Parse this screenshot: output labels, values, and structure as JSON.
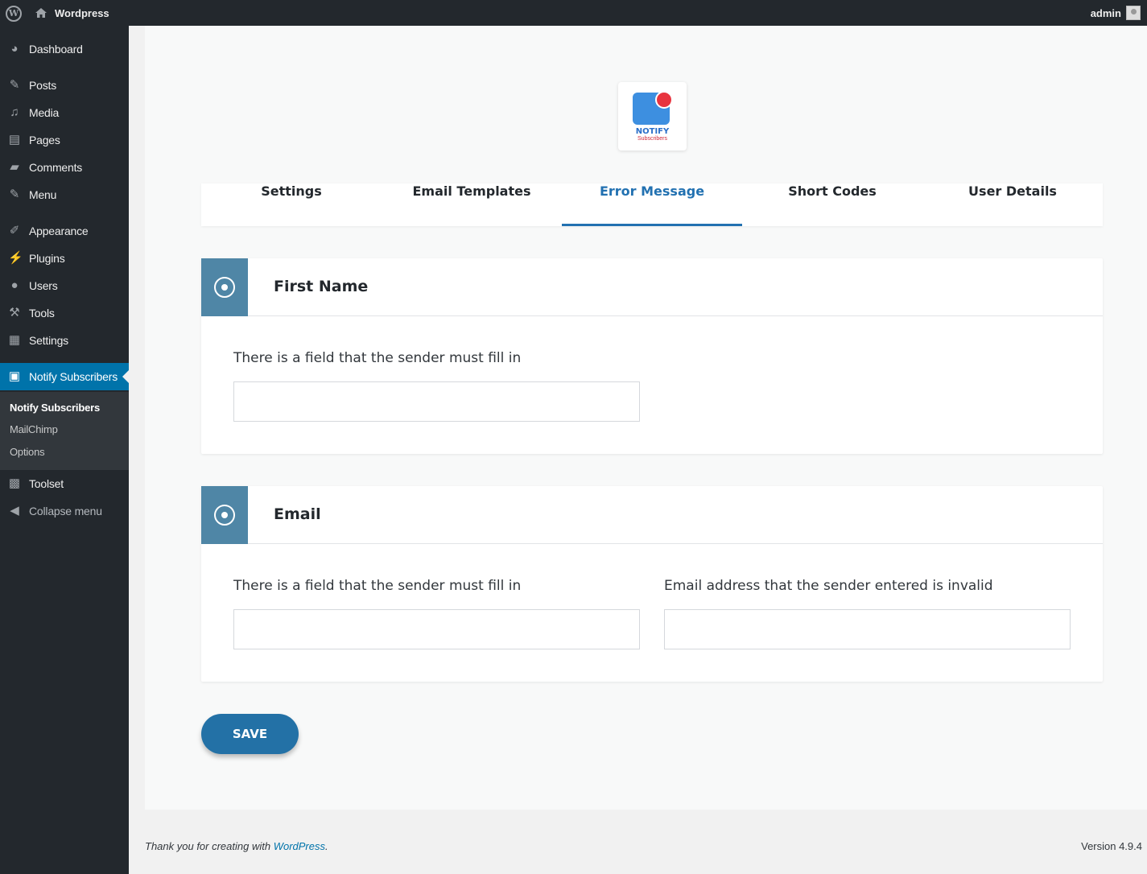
{
  "adminbar": {
    "site_name": "Wordpress",
    "user_name": "admin"
  },
  "sidebar": {
    "items": [
      {
        "label": "Dashboard",
        "icon": "dashboard-icon"
      },
      {
        "label": "Posts",
        "icon": "pin-icon"
      },
      {
        "label": "Media",
        "icon": "media-icon"
      },
      {
        "label": "Pages",
        "icon": "pages-icon"
      },
      {
        "label": "Comments",
        "icon": "comments-icon"
      },
      {
        "label": "Menu",
        "icon": "pin-icon"
      },
      {
        "label": "Appearance",
        "icon": "brush-icon"
      },
      {
        "label": "Plugins",
        "icon": "plug-icon"
      },
      {
        "label": "Users",
        "icon": "user-icon"
      },
      {
        "label": "Tools",
        "icon": "wrench-icon"
      },
      {
        "label": "Settings",
        "icon": "sliders-icon"
      },
      {
        "label": "Notify Subscribers",
        "icon": "notify-icon"
      },
      {
        "label": "Toolset",
        "icon": "toolset-icon"
      },
      {
        "label": "Collapse menu",
        "icon": "collapse-icon"
      }
    ],
    "submenu": [
      "Notify Subscribers",
      "MailChimp",
      "Options"
    ]
  },
  "logo": {
    "title": "NOTIFY",
    "subtitle": "Subscribers"
  },
  "tabs": [
    "Settings",
    "Email Templates",
    "Error Message",
    "Short Codes",
    "User Details"
  ],
  "active_tab": "Error Message",
  "cards": [
    {
      "title": "First Name",
      "fields": [
        {
          "label": "There is a field that the sender must fill in",
          "value": ""
        }
      ]
    },
    {
      "title": "Email",
      "fields": [
        {
          "label": "There is a field that the sender must fill in",
          "value": ""
        },
        {
          "label": "Email address that the sender entered is invalid",
          "value": ""
        }
      ]
    }
  ],
  "save_label": "SAVE",
  "footer": {
    "thanks_prefix": "Thank you for creating with ",
    "thanks_link": "WordPress",
    "thanks_suffix": ".",
    "version": "Version 4.9.4"
  },
  "colors": {
    "accent": "#2271b1",
    "sidebar_bg": "#23282d",
    "active_menu": "#0073aa",
    "card_icon_bg": "#4f86a6"
  }
}
